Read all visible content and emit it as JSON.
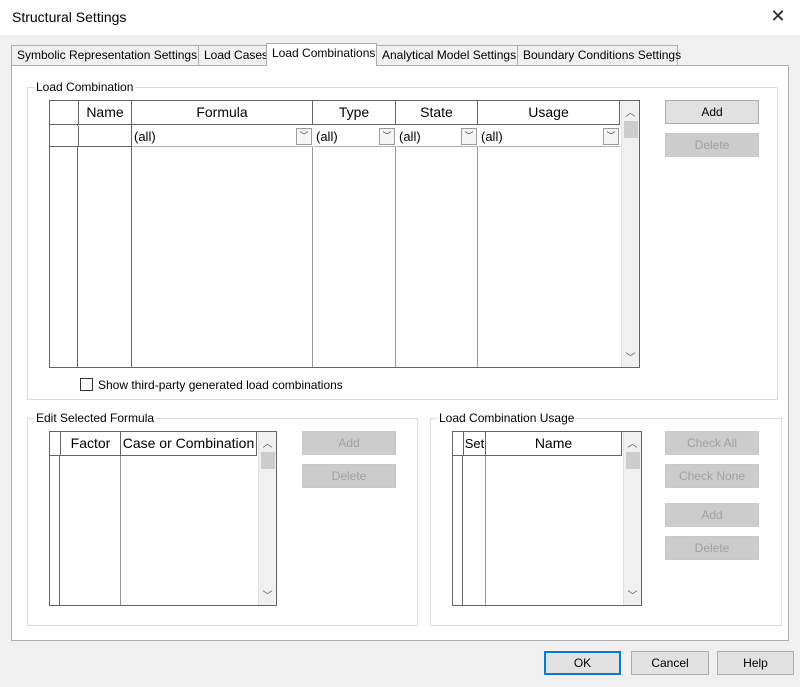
{
  "window": {
    "title": "Structural Settings"
  },
  "tabs": [
    {
      "label": "Symbolic Representation Settings"
    },
    {
      "label": "Load Cases"
    },
    {
      "label": "Load Combinations"
    },
    {
      "label": "Analytical Model Settings"
    },
    {
      "label": "Boundary Conditions Settings"
    }
  ],
  "load_combination": {
    "group_label": "Load Combination",
    "columns": [
      "Name",
      "Formula",
      "Type",
      "State",
      "Usage"
    ],
    "filters": [
      "(all)",
      "(all)",
      "(all)",
      "(all)"
    ],
    "add_label": "Add",
    "delete_label": "Delete",
    "third_party_label": "Show third-party generated load combinations"
  },
  "edit_formula": {
    "group_label": "Edit Selected Formula",
    "columns": [
      "Factor",
      "Case or Combination"
    ],
    "add_label": "Add",
    "delete_label": "Delete"
  },
  "usage": {
    "group_label": "Load Combination Usage",
    "columns": [
      "Set",
      "Name"
    ],
    "check_all_label": "Check All",
    "check_none_label": "Check None",
    "add_label": "Add",
    "delete_label": "Delete"
  },
  "footer": {
    "ok_label": "OK",
    "cancel_label": "Cancel",
    "help_label": "Help"
  }
}
